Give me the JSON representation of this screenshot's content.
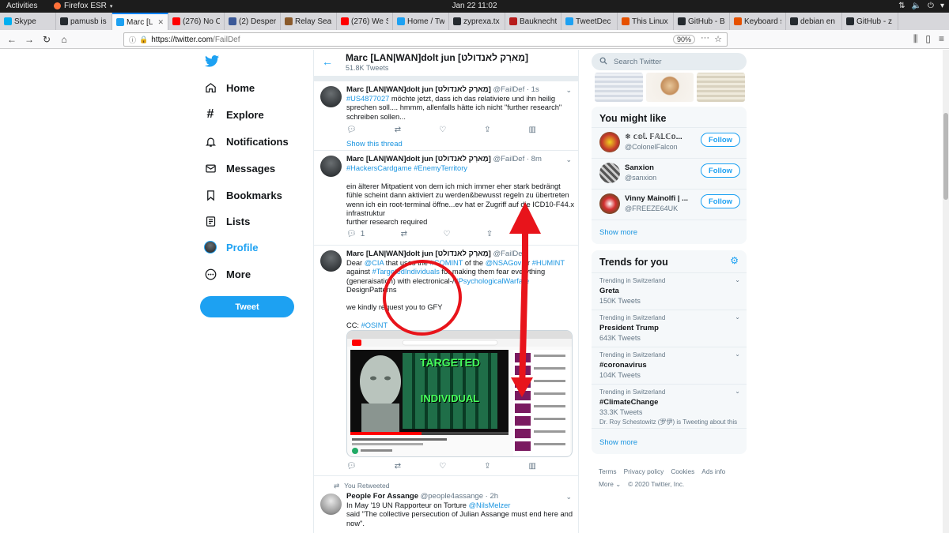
{
  "desktop": {
    "activities": "Activities",
    "app_name": "Firefox ESR",
    "clock": "Jan 22  11:02"
  },
  "browser": {
    "tabs": [
      {
        "label": "Skype",
        "color": "#00aff0"
      },
      {
        "label": "pamusb is",
        "color": "#24292e"
      },
      {
        "label": "Marc [L",
        "color": "#1da1f2",
        "active": true
      },
      {
        "label": "(276) No C",
        "color": "#ff0000"
      },
      {
        "label": "(2) Desper",
        "color": "#3b5998"
      },
      {
        "label": "Relay Sea",
        "color": "#8a5a2b"
      },
      {
        "label": "(276) We S",
        "color": "#ff0000"
      },
      {
        "label": "Home / Tw",
        "color": "#1da1f2"
      },
      {
        "label": "zyprexa.tx",
        "color": "#24292e"
      },
      {
        "label": "Bauknecht",
        "color": "#b71c1c"
      },
      {
        "label": "TweetDec",
        "color": "#1da1f2"
      },
      {
        "label": "This Linux",
        "color": "#e65100"
      },
      {
        "label": "GitHub - B",
        "color": "#24292e"
      },
      {
        "label": "Keyboard s",
        "color": "#e65100"
      },
      {
        "label": "debian en",
        "color": "#24292e"
      },
      {
        "label": "GitHub - z",
        "color": "#24292e"
      }
    ],
    "url_host": "https://twitter.com",
    "url_path": "/FailDef",
    "zoom": "90%"
  },
  "nav": {
    "items": [
      {
        "label": "Home"
      },
      {
        "label": "Explore"
      },
      {
        "label": "Notifications"
      },
      {
        "label": "Messages"
      },
      {
        "label": "Bookmarks"
      },
      {
        "label": "Lists"
      },
      {
        "label": "Profile"
      },
      {
        "label": "More"
      }
    ],
    "tweet_button": "Tweet"
  },
  "profile_header": {
    "name": "Marc [LAN|WAN]dolt jun [מַארְק לאנדולט]",
    "count": "51.8K Tweets"
  },
  "tweets": [
    {
      "name": "Marc [LAN|WAN]dolt jun [מַארְק לאנדולט]",
      "handle": "@FailDef",
      "time": "· 1s",
      "hashtag": "#US4877027",
      "text": " möchte jetzt, dass ich das relativiere und ihn heilig sprechen soll.... hmmm, allenfalls hätte ich nicht \"further research\" schreiben sollen...",
      "show_thread": "Show this thread"
    },
    {
      "name": "Marc [LAN|WAN]dolt jun [מַארְק לאנדולט]",
      "handle": "@FailDef",
      "time": "· 8m",
      "hashtags": "#HackersCardgame #EnemyTerritory",
      "line1": "ein älterer Mitpatient von dem ich mich immer eher stark bedrängt fühle scheint dann aktiviert zu werden&bewusst regeln zu übertreten wenn ich ein root-terminal öffne...ev hat er Zugriff auf die ICD10-F44.x infrastruktur",
      "line2": "further research required",
      "reply_count": "1"
    },
    {
      "name": "Marc [LAN|WAN]dolt jun [מַארְק לאנדולט]",
      "handle": "@FailDef",
      "p1": "Dear ",
      "m1": "@CIA",
      "p2": " that uses the ",
      "m2": "#COMINT",
      "p3": " of the ",
      "m3": "@NSAGov",
      "p4": " or ",
      "m4": "#HUMINT",
      "p5": " against ",
      "m5": "#TargetedIndividuals",
      "p6": " for making them fear everything (generaisation) with electronical-/",
      "m6": "#PsychologicalWarfare",
      "p7": " DesignPatterns",
      "p8": "we kindly request you to GFY",
      "cc_label": "CC: ",
      "cc_tag": "#OSINT",
      "media_title_1": "TARGETED",
      "media_title_2": "INDIVIDUAL"
    },
    {
      "retweet_note": "You Retweeted",
      "name": "People For Assange",
      "handle": "@people4assange",
      "time": "· 2h",
      "t1": "In May '19 UN Rapporteur on Torture ",
      "mention": "@NilsMelzer",
      "t2": " said \"The collective persecution of Julian Assange must end here and now\"."
    }
  ],
  "sidebar": {
    "search_placeholder": "Search Twitter",
    "wtf_title": "You might like",
    "wtf": [
      {
        "name": "❄ 𝕔𝕠𝕝. 𝔽𝔸𝕃ℂ𝕠...",
        "handle": "@ColonelFalcon",
        "follow": "Follow"
      },
      {
        "name": "Sanxion",
        "handle": "@sanxion",
        "follow": "Follow"
      },
      {
        "name": "Vinny Mainolfi | ...",
        "handle": "@FREEZE64UK",
        "follow": "Follow"
      }
    ],
    "show_more_1": "Show more",
    "trends_title": "Trends for you",
    "trends": [
      {
        "context": "Trending in Switzerland",
        "topic": "Greta",
        "count": "150K Tweets"
      },
      {
        "context": "Trending in Switzerland",
        "topic": "President Trump",
        "count": "643K Tweets"
      },
      {
        "context": "Trending in Switzerland",
        "topic": "#coronavirus",
        "count": "104K Tweets"
      },
      {
        "context": "Trending in Switzerland",
        "topic": "#ClimateChange",
        "count": "33.3K Tweets",
        "extra": "Dr. Roy Schestowitz (罗伊) is Tweeting about this"
      }
    ],
    "show_more_2": "Show more",
    "footer": {
      "links": [
        "Terms",
        "Privacy policy",
        "Cookies",
        "Ads info"
      ],
      "more": "More ⌄",
      "copyright": "© 2020 Twitter, Inc."
    }
  },
  "colors": {
    "twitter_blue": "#1da1f2",
    "annotation_red": "#e8141b"
  }
}
